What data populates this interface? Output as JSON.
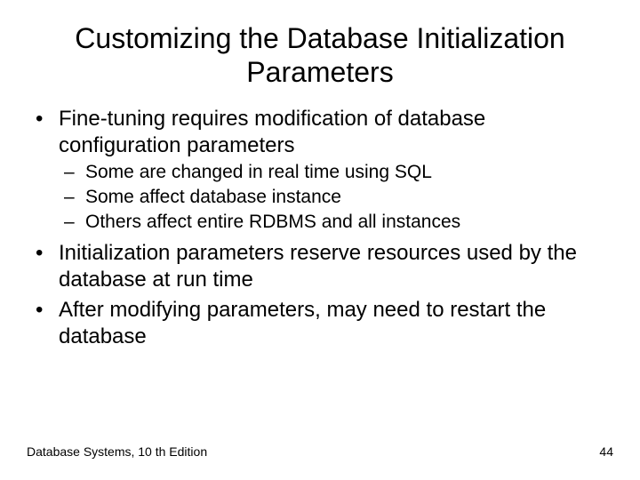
{
  "title": "Customizing the Database Initialization Parameters",
  "bullets": [
    {
      "text": "Fine-tuning requires modification of database configuration parameters",
      "children": [
        "Some are changed in real time using SQL",
        "Some affect database instance",
        "Others affect entire RDBMS and all instances"
      ]
    },
    {
      "text": "Initialization parameters reserve resources used by the database at run time",
      "children": []
    },
    {
      "text": "After modifying parameters, may need to restart the database",
      "children": []
    }
  ],
  "footer": {
    "left": "Database Systems, 10 th Edition",
    "right": "44"
  }
}
